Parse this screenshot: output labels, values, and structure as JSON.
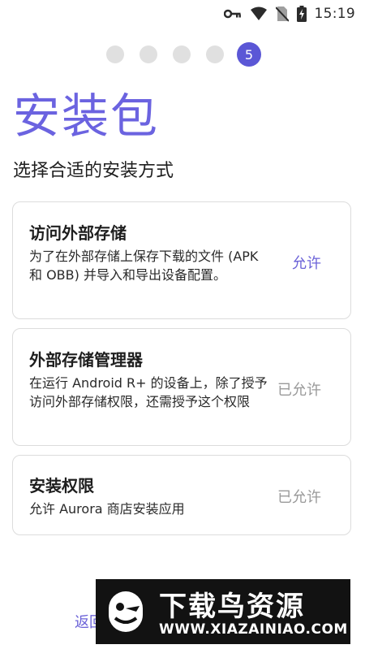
{
  "status_bar": {
    "time": "15:19",
    "icons": [
      "key-icon",
      "wifi-icon",
      "no-sim-icon",
      "battery-charging-icon"
    ]
  },
  "pager": {
    "steps": [
      {
        "label": "",
        "active": false
      },
      {
        "label": "",
        "active": false
      },
      {
        "label": "",
        "active": false
      },
      {
        "label": "",
        "active": false
      },
      {
        "label": "5",
        "active": true
      }
    ],
    "active_color": "#5b57d6"
  },
  "page": {
    "title": "安装包",
    "subtitle": "选择合适的安装方式"
  },
  "cards": [
    {
      "title": "访问外部存储",
      "description": "为了在外部存储上保存下载的文件 (APK 和 OBB) 并导入和导出设备配置。",
      "action": "允许",
      "enabled": true
    },
    {
      "title": "外部存储管理器",
      "description": "在运行 Android R+ 的设备上，除了授予访问外部存储权限，还需授予这个权限",
      "action": "已允许",
      "enabled": false
    },
    {
      "title": "安装权限",
      "description": "允许 Aurora 商店安装应用",
      "action": "已允许",
      "enabled": false
    }
  ],
  "footer": {
    "back_label": "返回"
  },
  "watermark": {
    "title": "下载鸟资源",
    "url": "WWW.XIAZAINIAO.COM"
  },
  "colors": {
    "accent": "#6c63d8",
    "title": "#6b63e0",
    "disabled": "#9a9a9a"
  }
}
